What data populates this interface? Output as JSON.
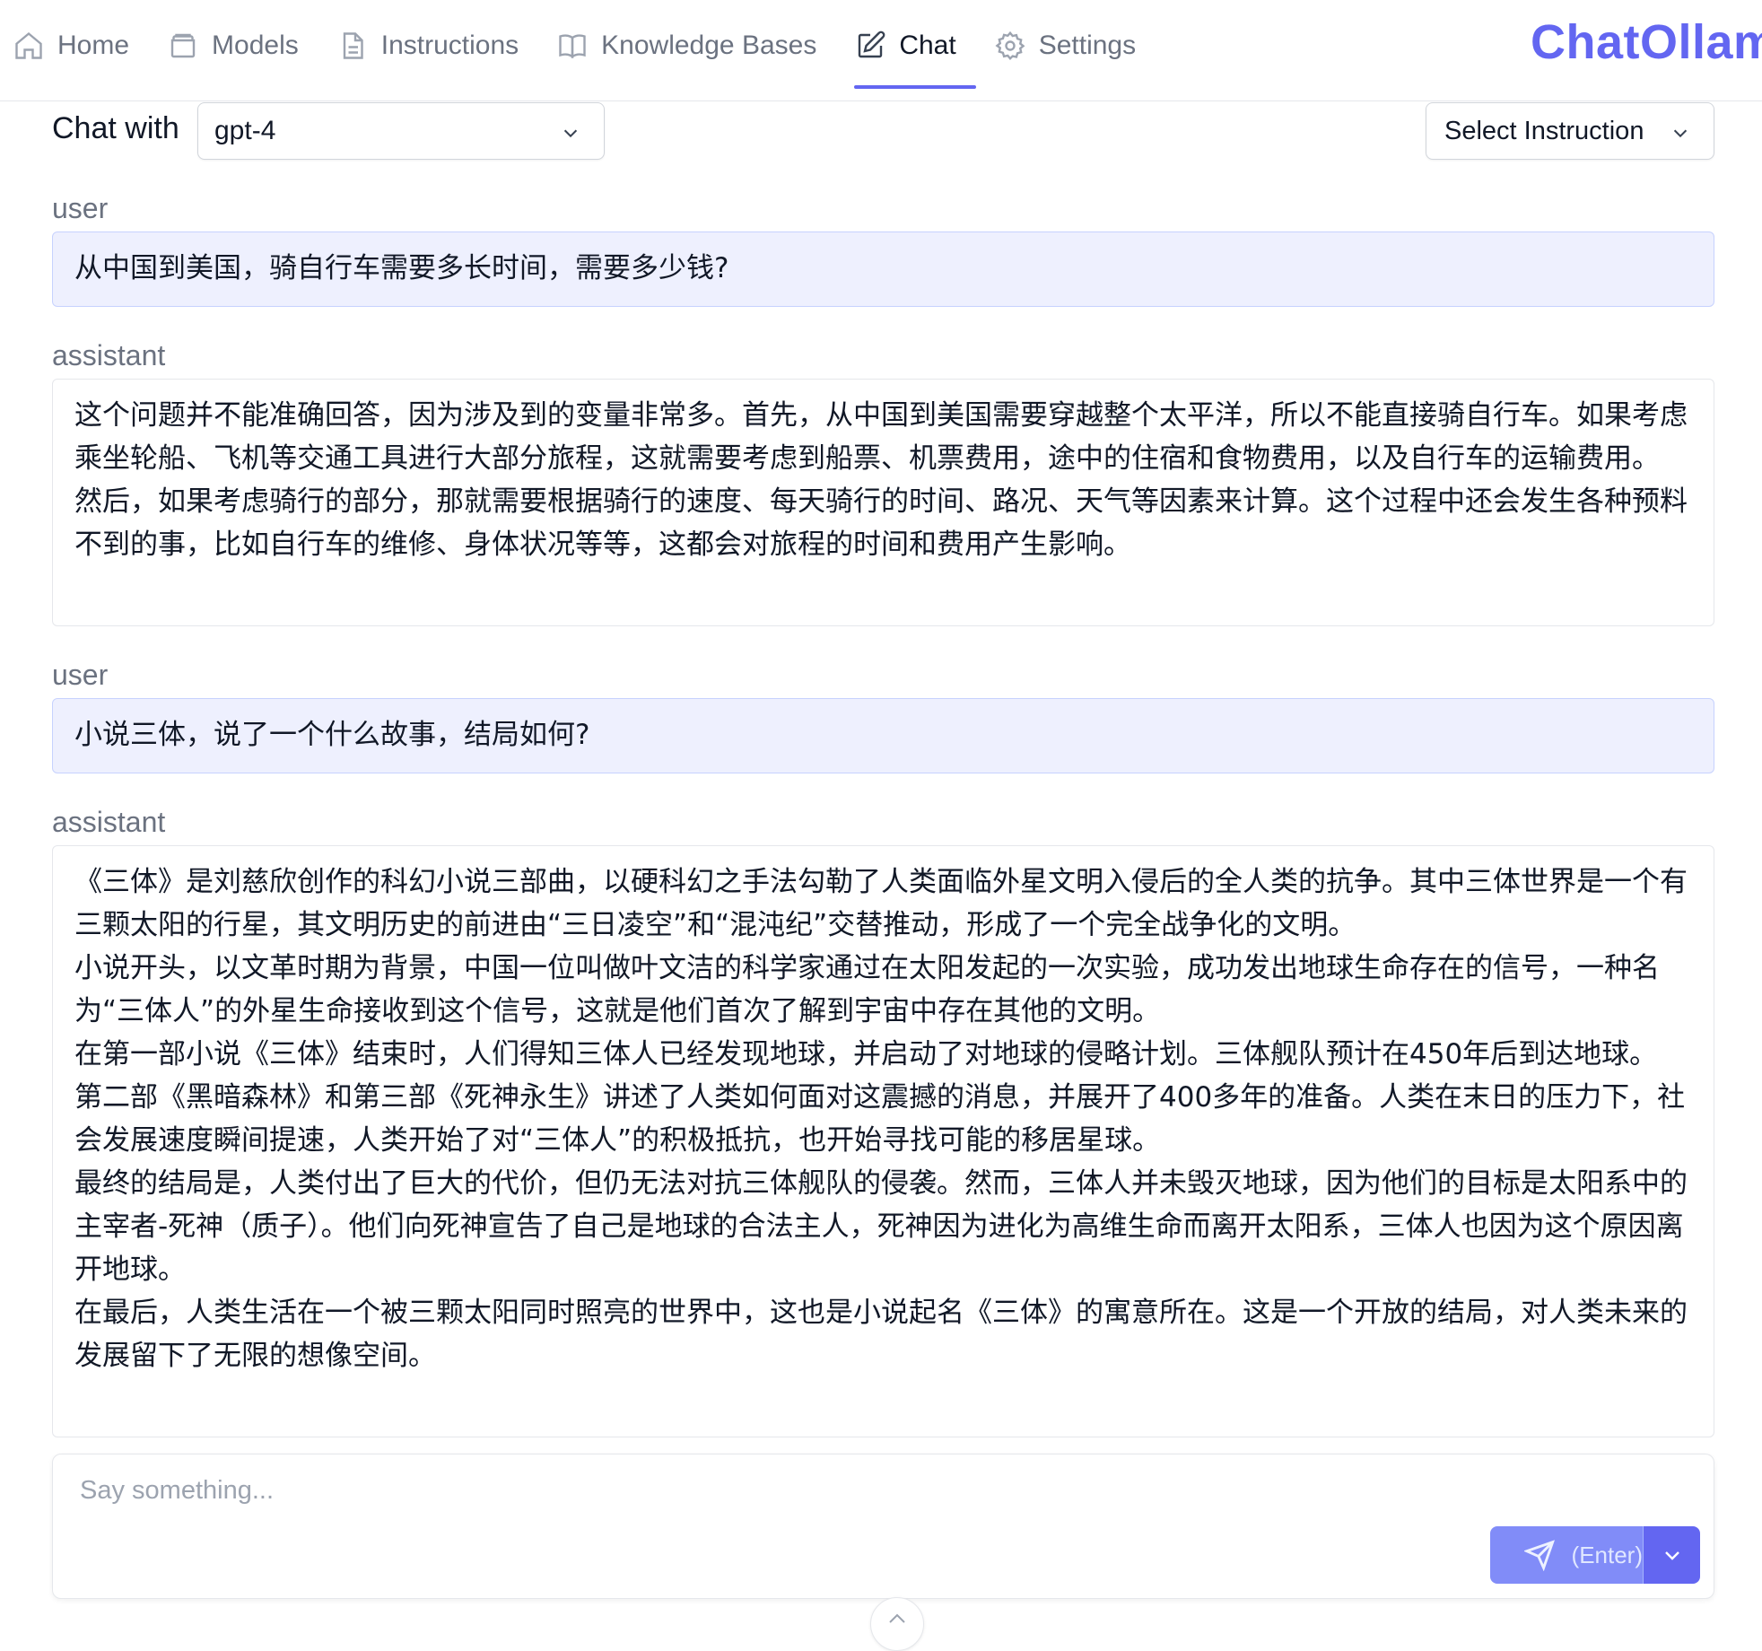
{
  "nav": {
    "items": [
      {
        "label": "Home",
        "icon": "home-icon"
      },
      {
        "label": "Models",
        "icon": "database-icon"
      },
      {
        "label": "Instructions",
        "icon": "document-icon"
      },
      {
        "label": "Knowledge Bases",
        "icon": "book-icon"
      },
      {
        "label": "Chat",
        "icon": "edit-icon",
        "active": true
      },
      {
        "label": "Settings",
        "icon": "gear-icon"
      }
    ],
    "brand": "ChatOllama"
  },
  "header": {
    "chat_with_label": "Chat with",
    "model_value": "gpt-4",
    "instruction_label": "Select Instruction"
  },
  "messages": [
    {
      "role": "user",
      "paragraphs": [
        "从中国到美国，骑自行车需要多长时间，需要多少钱?"
      ]
    },
    {
      "role": "assistant",
      "paragraphs": [
        "这个问题并不能准确回答，因为涉及到的变量非常多。首先，从中国到美国需要穿越整个太平洋，所以不能直接骑自行车。如果考虑乘坐轮船、飞机等交通工具进行大部分旅程，这就需要考虑到船票、机票费用，途中的住宿和食物费用，以及自行车的运输费用。",
        "然后，如果考虑骑行的部分，那就需要根据骑行的速度、每天骑行的时间、路况、天气等因素来计算。这个过程中还会发生各种预料不到的事，比如自行车的维修、身体状况等等，这都会对旅程的时间和费用产生影响。"
      ]
    },
    {
      "role": "user",
      "paragraphs": [
        "小说三体，说了一个什么故事，结局如何?"
      ]
    },
    {
      "role": "assistant",
      "paragraphs": [
        "《三体》是刘慈欣创作的科幻小说三部曲，以硬科幻之手法勾勒了人类面临外星文明入侵后的全人类的抗争。其中三体世界是一个有三颗太阳的行星，其文明历史的前进由“三日凌空”和“混沌纪”交替推动，形成了一个完全战争化的文明。",
        "小说开头，以文革时期为背景，中国一位叫做叶文洁的科学家通过在太阳发起的一次实验，成功发出地球生命存在的信号，一种名为“三体人”的外星生命接收到这个信号，这就是他们首次了解到宇宙中存在其他的文明。",
        "在第一部小说《三体》结束时，人们得知三体人已经发现地球，并启动了对地球的侵略计划。三体舰队预计在450年后到达地球。",
        "第二部《黑暗森林》和第三部《死神永生》讲述了人类如何面对这震撼的消息，并展开了400多年的准备。人类在末日的压力下，社会发展速度瞬间提速，人类开始了对“三体人”的积极抵抗，也开始寻找可能的移居星球。",
        "最终的结局是，人类付出了巨大的代价，但仍无法对抗三体舰队的侵袭。然而，三体人并未毁灭地球，因为他们的目标是太阳系中的主宰者-死神（质子）。他们向死神宣告了自己是地球的合法主人，死神因为进化为高维生命而离开太阳系，三体人也因为这个原因离开地球。",
        "在最后，人类生活在一个被三颗太阳同时照亮的世界中，这也是小说起名《三体》的寓意所在。这是一个开放的结局，对人类未来的发展留下了无限的想像空间。"
      ]
    }
  ],
  "composer": {
    "placeholder": "Say something...",
    "value": "",
    "send_label": "(Enter)"
  },
  "colors": {
    "accent": "#6366f1",
    "accent_light": "#818cf8",
    "user_bubble_bg": "#eef0fe"
  }
}
